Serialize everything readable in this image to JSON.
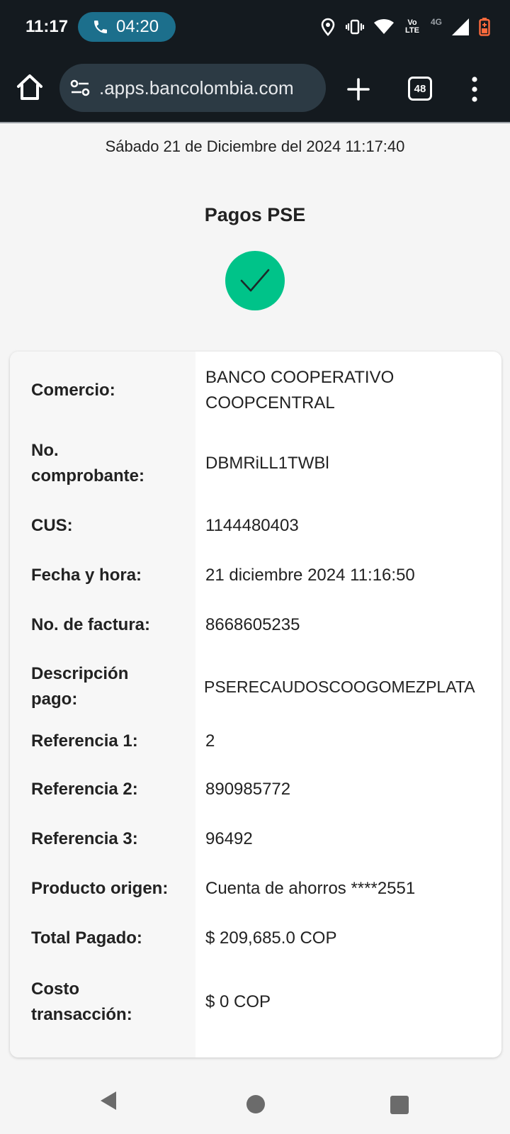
{
  "status_bar": {
    "time": "11:17",
    "call_duration": "04:20",
    "volte_label": "Vo LTE",
    "network_label": "4G",
    "icons": [
      "location-icon",
      "vibrate-icon",
      "wifi-icon",
      "volte-icon",
      "signal-icon",
      "battery-icon"
    ]
  },
  "browser": {
    "url": ".apps.bancolombia.com",
    "tab_count": "48"
  },
  "receipt": {
    "datetime": "Sábado 21 de Diciembre del 2024 11:17:40",
    "title": "Pagos PSE",
    "success_color": "#00c389",
    "rows": [
      {
        "label": "Comercio:",
        "value": "BANCO COOPERATIVO COOPCENTRAL"
      },
      {
        "label": "No. comprobante:",
        "value": "DBMRiLL1TWBl"
      },
      {
        "label": "CUS:",
        "value": "1144480403"
      },
      {
        "label": "Fecha y hora:",
        "value": "21 diciembre 2024 11:16:50"
      },
      {
        "label": "No. de factura:",
        "value": "8668605235"
      },
      {
        "label": "Descripción pago:",
        "value": "PSERECAUDOSCOOGOMEZPLATA"
      },
      {
        "label": "Referencia 1:",
        "value": "2"
      },
      {
        "label": "Referencia 2:",
        "value": "890985772"
      },
      {
        "label": "Referencia 3:",
        "value": "96492"
      },
      {
        "label": "Producto origen:",
        "value": "Cuenta de ahorros ****2551"
      },
      {
        "label": "Total Pagado:",
        "value": "$ 209,685.0 COP"
      },
      {
        "label": "Costo transacción:",
        "value": "$ 0 COP"
      }
    ]
  },
  "navigation": {
    "buttons": [
      "back-icon",
      "home-icon",
      "recents-icon"
    ]
  }
}
